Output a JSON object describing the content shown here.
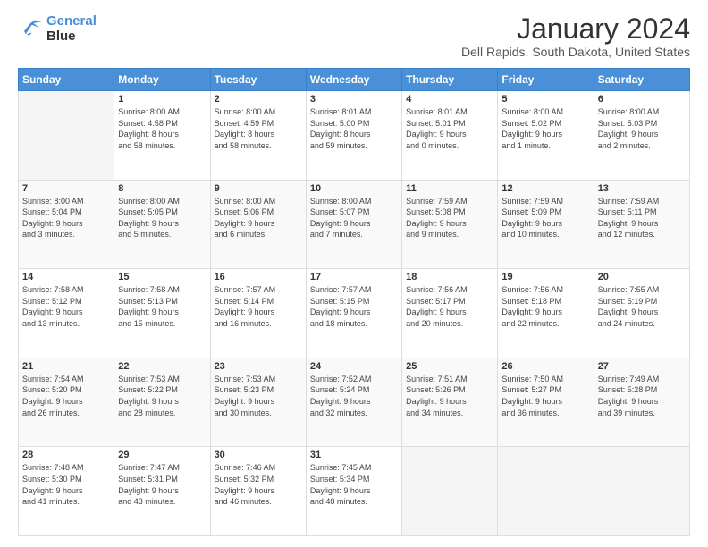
{
  "header": {
    "logo_line1": "General",
    "logo_line2": "Blue",
    "month_title": "January 2024",
    "location": "Dell Rapids, South Dakota, United States"
  },
  "calendar": {
    "days_of_week": [
      "Sunday",
      "Monday",
      "Tuesday",
      "Wednesday",
      "Thursday",
      "Friday",
      "Saturday"
    ],
    "weeks": [
      [
        {
          "day": "",
          "info": ""
        },
        {
          "day": "1",
          "info": "Sunrise: 8:00 AM\nSunset: 4:58 PM\nDaylight: 8 hours\nand 58 minutes."
        },
        {
          "day": "2",
          "info": "Sunrise: 8:00 AM\nSunset: 4:59 PM\nDaylight: 8 hours\nand 58 minutes."
        },
        {
          "day": "3",
          "info": "Sunrise: 8:01 AM\nSunset: 5:00 PM\nDaylight: 8 hours\nand 59 minutes."
        },
        {
          "day": "4",
          "info": "Sunrise: 8:01 AM\nSunset: 5:01 PM\nDaylight: 9 hours\nand 0 minutes."
        },
        {
          "day": "5",
          "info": "Sunrise: 8:00 AM\nSunset: 5:02 PM\nDaylight: 9 hours\nand 1 minute."
        },
        {
          "day": "6",
          "info": "Sunrise: 8:00 AM\nSunset: 5:03 PM\nDaylight: 9 hours\nand 2 minutes."
        }
      ],
      [
        {
          "day": "7",
          "info": "Sunrise: 8:00 AM\nSunset: 5:04 PM\nDaylight: 9 hours\nand 3 minutes."
        },
        {
          "day": "8",
          "info": "Sunrise: 8:00 AM\nSunset: 5:05 PM\nDaylight: 9 hours\nand 5 minutes."
        },
        {
          "day": "9",
          "info": "Sunrise: 8:00 AM\nSunset: 5:06 PM\nDaylight: 9 hours\nand 6 minutes."
        },
        {
          "day": "10",
          "info": "Sunrise: 8:00 AM\nSunset: 5:07 PM\nDaylight: 9 hours\nand 7 minutes."
        },
        {
          "day": "11",
          "info": "Sunrise: 7:59 AM\nSunset: 5:08 PM\nDaylight: 9 hours\nand 9 minutes."
        },
        {
          "day": "12",
          "info": "Sunrise: 7:59 AM\nSunset: 5:09 PM\nDaylight: 9 hours\nand 10 minutes."
        },
        {
          "day": "13",
          "info": "Sunrise: 7:59 AM\nSunset: 5:11 PM\nDaylight: 9 hours\nand 12 minutes."
        }
      ],
      [
        {
          "day": "14",
          "info": "Sunrise: 7:58 AM\nSunset: 5:12 PM\nDaylight: 9 hours\nand 13 minutes."
        },
        {
          "day": "15",
          "info": "Sunrise: 7:58 AM\nSunset: 5:13 PM\nDaylight: 9 hours\nand 15 minutes."
        },
        {
          "day": "16",
          "info": "Sunrise: 7:57 AM\nSunset: 5:14 PM\nDaylight: 9 hours\nand 16 minutes."
        },
        {
          "day": "17",
          "info": "Sunrise: 7:57 AM\nSunset: 5:15 PM\nDaylight: 9 hours\nand 18 minutes."
        },
        {
          "day": "18",
          "info": "Sunrise: 7:56 AM\nSunset: 5:17 PM\nDaylight: 9 hours\nand 20 minutes."
        },
        {
          "day": "19",
          "info": "Sunrise: 7:56 AM\nSunset: 5:18 PM\nDaylight: 9 hours\nand 22 minutes."
        },
        {
          "day": "20",
          "info": "Sunrise: 7:55 AM\nSunset: 5:19 PM\nDaylight: 9 hours\nand 24 minutes."
        }
      ],
      [
        {
          "day": "21",
          "info": "Sunrise: 7:54 AM\nSunset: 5:20 PM\nDaylight: 9 hours\nand 26 minutes."
        },
        {
          "day": "22",
          "info": "Sunrise: 7:53 AM\nSunset: 5:22 PM\nDaylight: 9 hours\nand 28 minutes."
        },
        {
          "day": "23",
          "info": "Sunrise: 7:53 AM\nSunset: 5:23 PM\nDaylight: 9 hours\nand 30 minutes."
        },
        {
          "day": "24",
          "info": "Sunrise: 7:52 AM\nSunset: 5:24 PM\nDaylight: 9 hours\nand 32 minutes."
        },
        {
          "day": "25",
          "info": "Sunrise: 7:51 AM\nSunset: 5:26 PM\nDaylight: 9 hours\nand 34 minutes."
        },
        {
          "day": "26",
          "info": "Sunrise: 7:50 AM\nSunset: 5:27 PM\nDaylight: 9 hours\nand 36 minutes."
        },
        {
          "day": "27",
          "info": "Sunrise: 7:49 AM\nSunset: 5:28 PM\nDaylight: 9 hours\nand 39 minutes."
        }
      ],
      [
        {
          "day": "28",
          "info": "Sunrise: 7:48 AM\nSunset: 5:30 PM\nDaylight: 9 hours\nand 41 minutes."
        },
        {
          "day": "29",
          "info": "Sunrise: 7:47 AM\nSunset: 5:31 PM\nDaylight: 9 hours\nand 43 minutes."
        },
        {
          "day": "30",
          "info": "Sunrise: 7:46 AM\nSunset: 5:32 PM\nDaylight: 9 hours\nand 46 minutes."
        },
        {
          "day": "31",
          "info": "Sunrise: 7:45 AM\nSunset: 5:34 PM\nDaylight: 9 hours\nand 48 minutes."
        },
        {
          "day": "",
          "info": ""
        },
        {
          "day": "",
          "info": ""
        },
        {
          "day": "",
          "info": ""
        }
      ]
    ]
  }
}
